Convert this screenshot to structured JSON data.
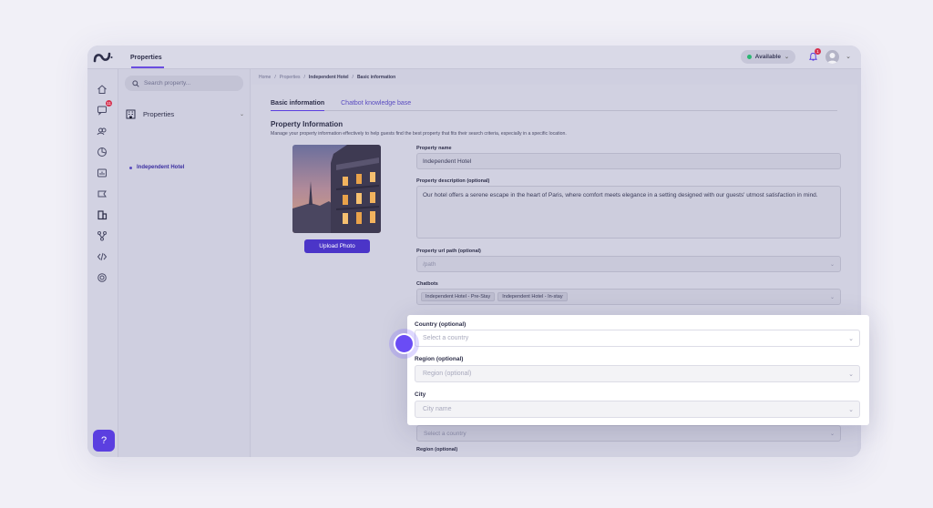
{
  "topbar": {
    "tab_label": "Properties",
    "status_label": "Available",
    "notification_count": "1"
  },
  "rail": {
    "messages_badge": "11"
  },
  "sidebar": {
    "search_placeholder": "Search property...",
    "section_label": "Properties",
    "items": [
      {
        "label": "Independent Hotel"
      }
    ]
  },
  "breadcrumb": [
    "Home",
    "Properties",
    "Independent Hotel",
    "Basic information"
  ],
  "tabs": [
    {
      "label": "Basic information",
      "active": true
    },
    {
      "label": "Chatbot knowledge base",
      "active": false
    }
  ],
  "section": {
    "title": "Property Information",
    "description": "Manage your property information effectively to help guests find the best property that fits their search criteria, especially in a specific location."
  },
  "photo": {
    "upload_label": "Upload Photo"
  },
  "form": {
    "name_label": "Property name",
    "name_value": "Independent Hotel",
    "desc_label": "Property description (optional)",
    "desc_value": "Our hotel offers a serene escape in the heart of Paris, where comfort meets elegance in a setting designed with our guests' utmost satisfaction in mind.",
    "url_label": "Property url path (optional)",
    "url_placeholder": "/path",
    "chatbots_label": "Chatbots",
    "chatbots": [
      "Independent Hotel - Pre-Stay",
      "Independent Hotel - In-stay"
    ],
    "country_placeholder_behind": "Select a country",
    "region_label_behind": "Region (optional)"
  },
  "popup": {
    "country_label": "Country (optional)",
    "country_placeholder": "Select a country",
    "region_label": "Region (optional)",
    "region_placeholder": "Region (optional)",
    "city_label": "City",
    "city_placeholder": "City name"
  },
  "colors": {
    "accent": "#5b3fe0",
    "badge": "#d6314f",
    "available": "#2bb673"
  },
  "icons": {
    "rail": [
      "home-icon",
      "messages-icon",
      "users-icon",
      "palette-icon",
      "analytics-icon",
      "campaign-icon",
      "properties-icon",
      "integrations-icon",
      "code-icon",
      "settings-icon"
    ]
  }
}
